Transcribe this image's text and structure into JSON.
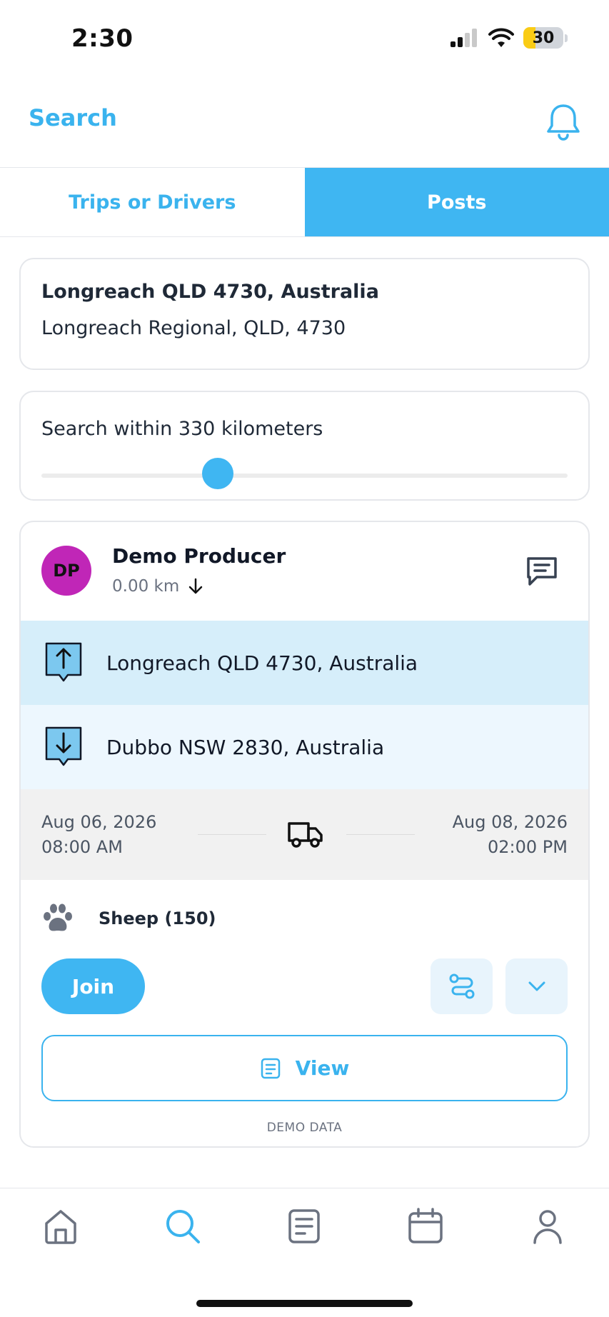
{
  "status_bar": {
    "time": "2:30",
    "battery": "30",
    "battery_level": 0.3
  },
  "header": {
    "title": "Search"
  },
  "tabs": [
    {
      "label": "Trips or Drivers",
      "active": false
    },
    {
      "label": "Posts",
      "active": true
    }
  ],
  "location": {
    "title": "Longreach QLD 4730, Australia",
    "subtitle": "Longreach Regional, QLD, 4730"
  },
  "radius": {
    "label": "Search within 330 kilometers",
    "slider_fraction": 0.335
  },
  "post": {
    "avatar_initials": "DP",
    "avatar_color": "#c026b7",
    "poster_name": "Demo Producer",
    "distance": "0.00 km",
    "pickup": "Longreach QLD 4730, Australia",
    "dropoff": "Dubbo NSW 2830, Australia",
    "start_date": "Aug 06, 2026",
    "start_time": "08:00 AM",
    "end_date": "Aug 08, 2026",
    "end_time": "02:00 PM",
    "livestock": "Sheep (150)",
    "join_label": "Join",
    "view_label": "View",
    "footer": "DEMO DATA"
  },
  "colors": {
    "accent": "#3fb6f2",
    "pickup_bg": "#d6eefa",
    "dropoff_bg": "#edf7fe"
  },
  "bottom_nav": [
    {
      "icon": "home-icon",
      "active": false
    },
    {
      "icon": "search-icon",
      "active": true
    },
    {
      "icon": "posts-icon",
      "active": false
    },
    {
      "icon": "calendar-icon",
      "active": false
    },
    {
      "icon": "profile-icon",
      "active": false
    }
  ]
}
